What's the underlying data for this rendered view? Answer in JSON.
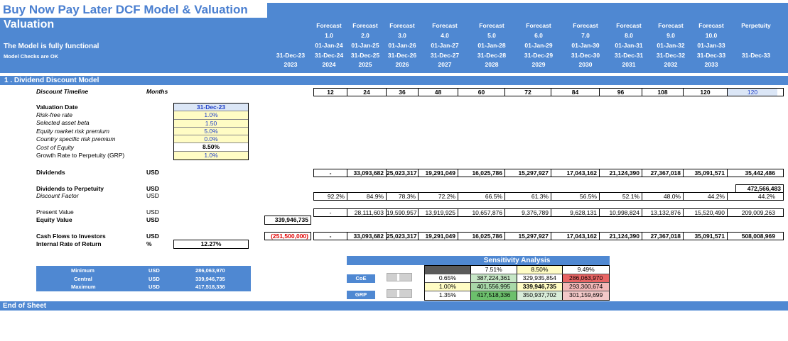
{
  "title": "Buy Now Pay Later DCF Model & Valuation",
  "header": {
    "section_name": "Valuation",
    "functional_text": "The Model is fully functional",
    "checks_text": "Model Checks are OK",
    "base_col": {
      "end": "31-Dec-23",
      "year": "2023"
    },
    "forecast_cols": [
      {
        "label": "Forecast",
        "num": "1.0",
        "start": "01-Jan-24",
        "end": "31-Dec-24",
        "year": "2024"
      },
      {
        "label": "Forecast",
        "num": "2.0",
        "start": "01-Jan-25",
        "end": "31-Dec-25",
        "year": "2025"
      },
      {
        "label": "Forecast",
        "num": "3.0",
        "start": "01-Jan-26",
        "end": "31-Dec-26",
        "year": "2026"
      },
      {
        "label": "Forecast",
        "num": "4.0",
        "start": "01-Jan-27",
        "end": "31-Dec-27",
        "year": "2027"
      },
      {
        "label": "Forecast",
        "num": "5.0",
        "start": "01-Jan-28",
        "end": "31-Dec-28",
        "year": "2028"
      },
      {
        "label": "Forecast",
        "num": "6.0",
        "start": "01-Jan-29",
        "end": "31-Dec-29",
        "year": "2029"
      },
      {
        "label": "Forecast",
        "num": "7.0",
        "start": "01-Jan-30",
        "end": "31-Dec-30",
        "year": "2030"
      },
      {
        "label": "Forecast",
        "num": "8.0",
        "start": "01-Jan-31",
        "end": "31-Dec-31",
        "year": "2031"
      },
      {
        "label": "Forecast",
        "num": "9.0",
        "start": "01-Jan-32",
        "end": "31-Dec-32",
        "year": "2032"
      },
      {
        "label": "Forecast",
        "num": "10.0",
        "start": "01-Jan-33",
        "end": "31-Dec-33",
        "year": "2033"
      }
    ],
    "perpetuity_col": {
      "label": "Perpetuity",
      "end": "31-Dec-33"
    }
  },
  "section": "1 .  Dividend Discount Model",
  "labels": {
    "discount_timeline": "Discount Timeline",
    "months": "Months",
    "valuation_date": "Valuation Date",
    "risk_free": "Risk-free rate",
    "asset_beta": "Selected asset beta",
    "equity_premium": "Equity market risk premium",
    "country_premium": "Country specific risk premium",
    "cost_of_equity": "Cost of Equity",
    "grp": "Growth Rate to Perpetuity (GRP)",
    "dividends": "Dividends",
    "dividends_perp": "Dividends to Perpetuity",
    "discount_factor": "Discount Factor",
    "present_value": "Present Value",
    "equity_value": "Equity Value",
    "cash_flows": "Cash Flows to Investors",
    "irr": "Internal Rate of Return",
    "usd": "USD",
    "pct": "%"
  },
  "inputs": {
    "valuation_date": "31-Dec-23",
    "risk_free": "1.0%",
    "asset_beta": "1.50",
    "equity_premium": "5.0%",
    "country_premium": "0.0%",
    "cost_of_equity": "8.50%",
    "grp": "1.0%"
  },
  "timeline": [
    "12",
    "24",
    "36",
    "48",
    "60",
    "72",
    "84",
    "96",
    "108",
    "120",
    "120"
  ],
  "dividends": [
    "-",
    "33,093,682",
    "25,023,317",
    "19,291,049",
    "16,025,786",
    "15,297,927",
    "17,043,162",
    "21,124,390",
    "27,367,018",
    "35,091,571",
    "35,442,486"
  ],
  "dividends_perp": "472,566,483",
  "discount_factor": [
    "92.2%",
    "84.9%",
    "78.3%",
    "72.2%",
    "66.5%",
    "61.3%",
    "56.5%",
    "52.1%",
    "48.0%",
    "44.2%",
    "44.2%"
  ],
  "present_value": [
    "-",
    "28,111,603",
    "19,590,957",
    "13,919,925",
    "10,657,876",
    "9,376,789",
    "9,628,131",
    "10,998,824",
    "13,132,876",
    "15,520,490",
    "209,009,263"
  ],
  "equity_value": "339,946,735",
  "cash_flows_base": "(251,500,000)",
  "cash_flows": [
    "-",
    "33,093,682",
    "25,023,317",
    "19,291,049",
    "16,025,786",
    "15,297,927",
    "17,043,162",
    "21,124,390",
    "27,367,018",
    "35,091,571",
    "508,008,969"
  ],
  "irr": "12.27%",
  "summary": [
    {
      "label": "Minimum",
      "unit": "USD",
      "value": "286,063,970"
    },
    {
      "label": "Central",
      "unit": "USD",
      "value": "339,946,735"
    },
    {
      "label": "Maximum",
      "unit": "USD",
      "value": "417,518,336"
    }
  ],
  "sensitivity": {
    "title": "Sensitivity Analysis",
    "coe_button": "CoE",
    "grp_button": "GRP",
    "col_headers": [
      "7.51%",
      "8.50%",
      "9.49%"
    ],
    "rows": [
      {
        "grp": "0.65%",
        "values": [
          "387,224,361",
          "329,935,854",
          "286,063,970"
        ]
      },
      {
        "grp": "1.00%",
        "values": [
          "401,556,995",
          "339,946,735",
          "293,300,674"
        ]
      },
      {
        "grp": "1.35%",
        "values": [
          "417,518,336",
          "350,937,702",
          "301,159,699"
        ]
      }
    ],
    "colors": {
      "green_light": "#c6e6c6",
      "green_dark": "#6cc06c",
      "red_light": "#f3b8b8",
      "red_dark": "#e86464",
      "yellow": "#fffcc4",
      "grey": "#d9d9d9"
    }
  },
  "end_label": "End of Sheet"
}
